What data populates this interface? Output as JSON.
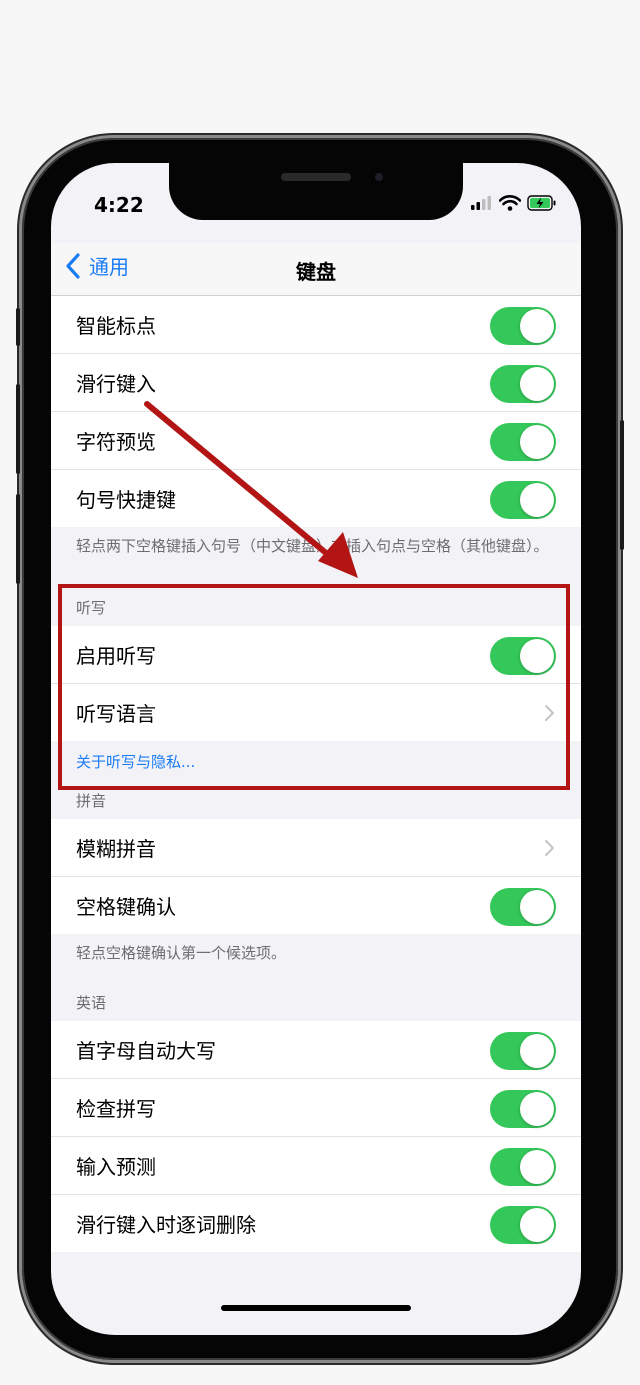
{
  "status_bar": {
    "time": "4:22"
  },
  "nav": {
    "back_label": "通用",
    "title": "键盘"
  },
  "group_top": {
    "rows": [
      {
        "label": "智能标点",
        "control": "toggle",
        "on": true
      },
      {
        "label": "滑行键入",
        "control": "toggle",
        "on": true
      },
      {
        "label": "字符预览",
        "control": "toggle",
        "on": true
      },
      {
        "label": "句号快捷键",
        "control": "toggle",
        "on": true
      }
    ],
    "footer": "轻点两下空格键插入句号（中文键盘）或插入句点与空格（其他键盘）。"
  },
  "dictation": {
    "header": "听写",
    "rows": [
      {
        "label": "启用听写",
        "control": "toggle",
        "on": true
      },
      {
        "label": "听写语言",
        "control": "chevron"
      }
    ],
    "link": "关于听写与隐私..."
  },
  "pinyin": {
    "header": "拼音",
    "rows": [
      {
        "label": "模糊拼音",
        "control": "chevron"
      },
      {
        "label": "空格键确认",
        "control": "toggle",
        "on": true
      }
    ],
    "footer": "轻点空格键确认第一个候选项。"
  },
  "english": {
    "header": "英语",
    "rows": [
      {
        "label": "首字母自动大写",
        "control": "toggle",
        "on": true
      },
      {
        "label": "检查拼写",
        "control": "toggle",
        "on": true
      },
      {
        "label": "输入预测",
        "control": "toggle",
        "on": true
      },
      {
        "label": "滑行键入时逐词删除",
        "control": "toggle",
        "on": true
      }
    ]
  },
  "colors": {
    "accent_blue": "#1a7cf5",
    "toggle_green": "#34c759",
    "annotation_red": "#b31515",
    "grouped_background": "#f2f2f7"
  },
  "icons": [
    "chevron-left-icon",
    "chevron-right-icon",
    "signal-icon",
    "wifi-icon",
    "battery-charging-icon"
  ]
}
